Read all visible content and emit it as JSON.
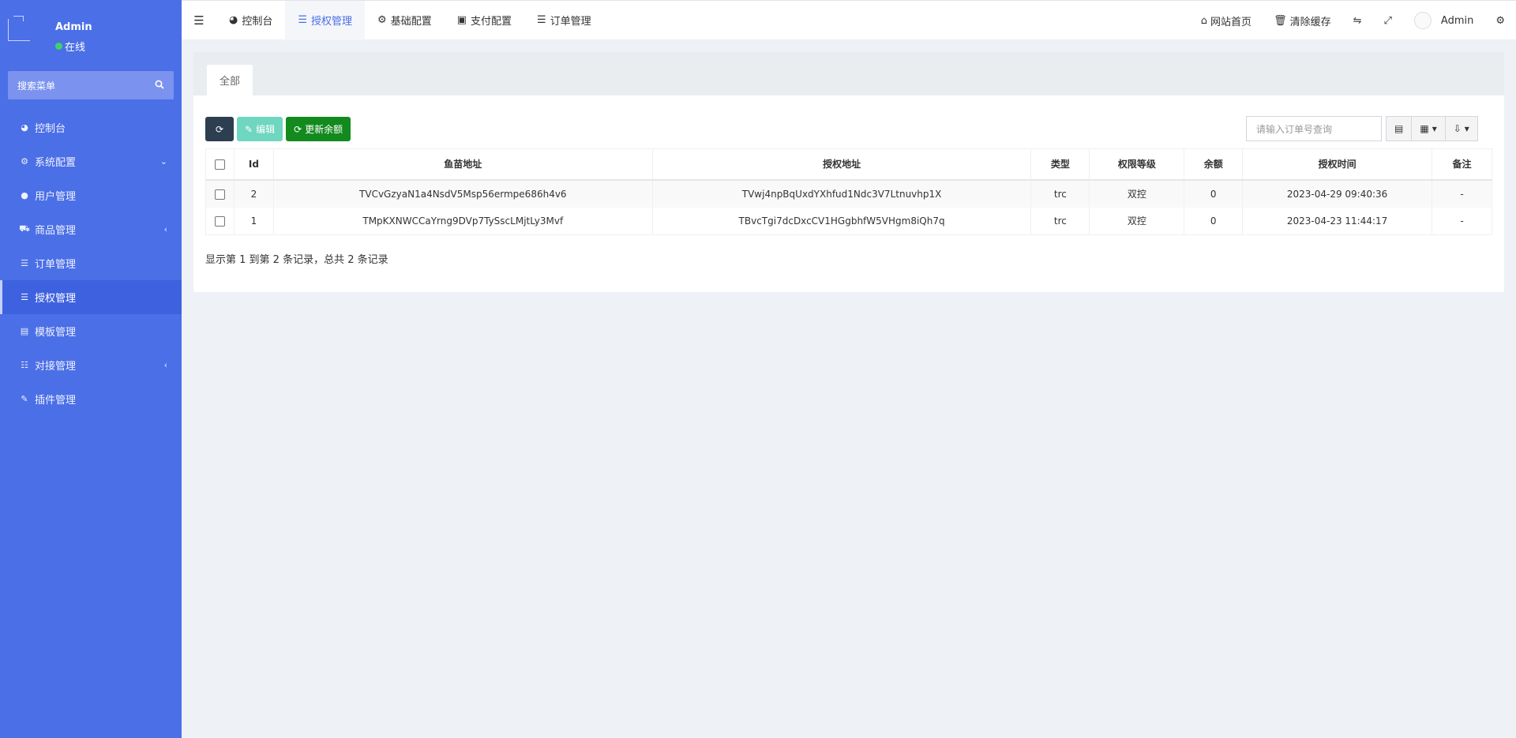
{
  "sidebar": {
    "user": {
      "name": "Admin",
      "status": "在线"
    },
    "search_placeholder": "搜索菜单",
    "items": [
      {
        "label": "控制台",
        "icon": "dashboard-icon",
        "chevron": ""
      },
      {
        "label": "系统配置",
        "icon": "gear-icon",
        "chevron": "⌄"
      },
      {
        "label": "用户管理",
        "icon": "user-icon",
        "chevron": ""
      },
      {
        "label": "商品管理",
        "icon": "cart-icon",
        "chevron": "‹"
      },
      {
        "label": "订单管理",
        "icon": "list-icon",
        "chevron": ""
      },
      {
        "label": "授权管理",
        "icon": "list-icon",
        "chevron": ""
      },
      {
        "label": "模板管理",
        "icon": "template-icon",
        "chevron": ""
      },
      {
        "label": "对接管理",
        "icon": "sliders-icon",
        "chevron": "‹"
      },
      {
        "label": "插件管理",
        "icon": "plugin-icon",
        "chevron": ""
      }
    ],
    "active_index": 5
  },
  "navbar": {
    "tabs": [
      {
        "label": "控制台",
        "icon": "dashboard-icon"
      },
      {
        "label": "授权管理",
        "icon": "list-icon"
      },
      {
        "label": "基础配置",
        "icon": "gear-icon"
      },
      {
        "label": "支付配置",
        "icon": "payment-icon"
      },
      {
        "label": "订单管理",
        "icon": "list-icon"
      }
    ],
    "active_tab": 1,
    "home_label": "网站首页",
    "clear_cache_label": "清除缓存",
    "admin_label": "Admin"
  },
  "panel": {
    "tab_label": "全部",
    "buttons": {
      "edit": "编辑",
      "update_balance": "更新余额"
    },
    "search_placeholder": "请输入订单号查询",
    "columns": [
      "Id",
      "鱼苗地址",
      "授权地址",
      "类型",
      "权限等级",
      "余额",
      "授权时间",
      "备注"
    ],
    "rows": [
      {
        "id": "2",
        "fish_address": "TVCvGzyaN1a4NsdV5Msp56ermpe686h4v6",
        "auth_address": "TVwj4npBqUxdYXhfud1Ndc3V7Ltnuvhp1X",
        "type": "trc",
        "level": "双控",
        "balance": "0",
        "time": "2023-04-29 09:40:36",
        "note": "-"
      },
      {
        "id": "1",
        "fish_address": "TMpKXNWCCaYrng9DVp7TySscLMjtLy3Mvf",
        "auth_address": "TBvcTgi7dcDxcCV1HGgbhfW5VHgm8iQh7q",
        "type": "trc",
        "level": "双控",
        "balance": "0",
        "time": "2023-04-23 11:44:17",
        "note": "-"
      }
    ],
    "pager_info": "显示第 1 到第 2 条记录，总共 2 条记录"
  },
  "colors": {
    "sidebar": "#4b6fe6",
    "active_tab": "#4b6fe6",
    "btn_green": "#128a1e",
    "btn_edit": "#6fd6c0",
    "btn_dark": "#2c3e50"
  }
}
